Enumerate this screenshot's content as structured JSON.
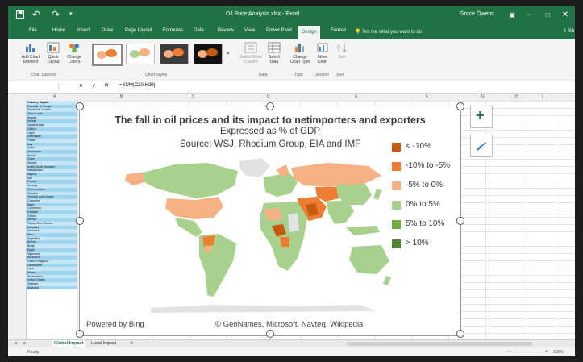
{
  "window": {
    "title": "Oil Price Analysis.xlsx - Excel",
    "user": "Grace Owens"
  },
  "tabs": [
    "File",
    "Home",
    "Insert",
    "Draw",
    "Page Layout",
    "Formulas",
    "Data",
    "Review",
    "View",
    "Power Pivot",
    "Design",
    "Format"
  ],
  "active_tab": "Design",
  "tell_me": "Tell me what you want to do",
  "share": "Sh",
  "ribbon": {
    "add_chart_element": "Add Chart Element",
    "quick_layout": "Quick Layout",
    "change_colors": "Change Colors",
    "switch_row_column": "Switch Row/ Column",
    "select_data": "Select Data",
    "change_chart_type": "Change Chart Type",
    "move_chart": "Move Chart",
    "sort": "Sort",
    "groups": {
      "chart_layouts": "Chart Layouts",
      "chart_styles": "Chart Styles",
      "data": "Data",
      "type": "Type",
      "location": "Location",
      "sort": "Sort"
    }
  },
  "formula_bar": {
    "name_box": "",
    "cancel": "✕",
    "enter": "✓",
    "fx": "fx",
    "formula": "=SUM(C20:H20)"
  },
  "columns": [
    "A",
    "B",
    "C",
    "D",
    "E",
    "F",
    "G",
    "H",
    "I"
  ],
  "country_list": [
    "Country Impact",
    "Republic of Congo",
    "Equatorial Guinea",
    "Timor-Leste",
    "Angola",
    "Kuwait",
    "Saudi Arabia",
    "Gabon",
    "Libya",
    "Azerbaijan",
    "Oman",
    "Iraq",
    "Qatar",
    "Venezuela",
    "Brunei",
    "Chad",
    "Algeria",
    "United Arab Emirates",
    "Kazakhstan",
    "Nigeria",
    "Iran",
    "Russia",
    "Norway",
    "Turkmenistan",
    "Ecuador",
    "Trinidad and Tobago",
    "Colombia",
    "Niger",
    "Cameroon",
    "Canada",
    "Ghana",
    "Mexico",
    "Papua New Guinea",
    "Malaysia",
    "Denmark",
    "Peru",
    "Argentina",
    "Bolivia",
    "Brazil",
    "Egypt",
    "Myanmar",
    "Suriname",
    "United Kingdom",
    "Uzbekistan",
    "Laos",
    "Yemen",
    "Switzerland",
    "United States",
    "Vietnam",
    "Australia"
  ],
  "chart": {
    "title": "The fall in oil prices and its impact to netimporters and exporters",
    "subtitle": "Expressed as % of GDP",
    "source": "Source: WSJ, Rhodium Group, EIA and IMF",
    "powered_by": "Powered by Bing",
    "credits": "© GeoNames, Microsoft, Navteq, Wikipedia",
    "legend": [
      {
        "label": "< -10%",
        "color": "#c55a11"
      },
      {
        "label": "-10% to -5%",
        "color": "#ed7d31"
      },
      {
        "label": "-5% to 0%",
        "color": "#f4b183"
      },
      {
        "label": "0% to 5%",
        "color": "#a9d18e"
      },
      {
        "label": "5% to 10%",
        "color": "#70ad47"
      },
      {
        "label": "> 10%",
        "color": "#548235"
      }
    ]
  },
  "side_buttons": {
    "add_element": "+",
    "style": "brush"
  },
  "sheets": [
    "Global Impact",
    "Local Impact"
  ],
  "active_sheet": "Global Impact",
  "status": {
    "ready": "Ready",
    "zoom": "100%"
  }
}
